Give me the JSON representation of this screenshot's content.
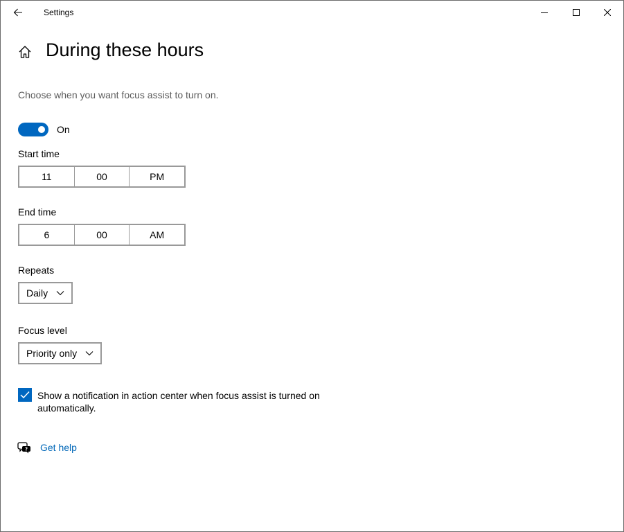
{
  "window": {
    "app_title": "Settings"
  },
  "header": {
    "page_title": "During these hours",
    "description": "Choose when you want focus assist to turn on."
  },
  "toggle": {
    "state": "on",
    "label": "On",
    "accent_color": "#0067c0"
  },
  "start_time": {
    "label": "Start time",
    "hour": "11",
    "minute": "00",
    "period": "PM"
  },
  "end_time": {
    "label": "End time",
    "hour": "6",
    "minute": "00",
    "period": "AM"
  },
  "repeats": {
    "label": "Repeats",
    "selected": "Daily"
  },
  "focus_level": {
    "label": "Focus level",
    "selected": "Priority only"
  },
  "notification_checkbox": {
    "checked": true,
    "label": "Show a notification in action center when focus assist is turned on automatically."
  },
  "help": {
    "link_text": "Get help",
    "link_color": "#0067b8"
  },
  "icons": {
    "back": "back-arrow-icon",
    "minimize": "minimize-icon",
    "maximize": "maximize-icon",
    "close": "close-icon",
    "home": "home-icon",
    "dropdown": "chevron-down-icon",
    "checkmark": "checkmark-icon",
    "help": "help-chat-icon"
  }
}
